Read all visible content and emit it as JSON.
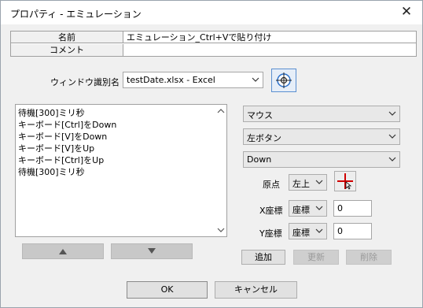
{
  "window": {
    "title": "プロパティ - エミュレーション",
    "close_label": "✕"
  },
  "properties": [
    {
      "key": "名前",
      "value": "エミュレーション_Ctrl+Vで貼り付け"
    },
    {
      "key": "コメント",
      "value": ""
    }
  ],
  "window_id": {
    "label": "ウィンドウ識別名",
    "value": "testDate.xlsx - Excel",
    "finder_icon": "window-finder-crosshair-icon"
  },
  "actions_list": [
    "待機[300]ミリ秒",
    "キーボード[Ctrl]をDown",
    "キーボード[V]をDown",
    "キーボード[V]をUp",
    "キーボード[Ctrl]をUp",
    "待機[300]ミリ秒"
  ],
  "move_buttons": {
    "up_icon": "triangle-up-icon",
    "down_icon": "triangle-down-icon"
  },
  "input_device": "マウス",
  "mouse_button": "左ボタン",
  "mouse_action": "Down",
  "origin": {
    "label": "原点",
    "value": "左上",
    "picker_icon": "crosshair-picker-icon"
  },
  "x_coord": {
    "label": "X座標",
    "mode": "座標",
    "value": "0"
  },
  "y_coord": {
    "label": "Y座標",
    "mode": "座標",
    "value": "0"
  },
  "edit_buttons": {
    "add": "追加",
    "update": "更新",
    "delete": "削除"
  },
  "footer": {
    "ok": "OK",
    "cancel": "キャンセル"
  },
  "colors": {
    "crosshair_red": "#d00000",
    "finder_blue": "#2a6fc9"
  }
}
